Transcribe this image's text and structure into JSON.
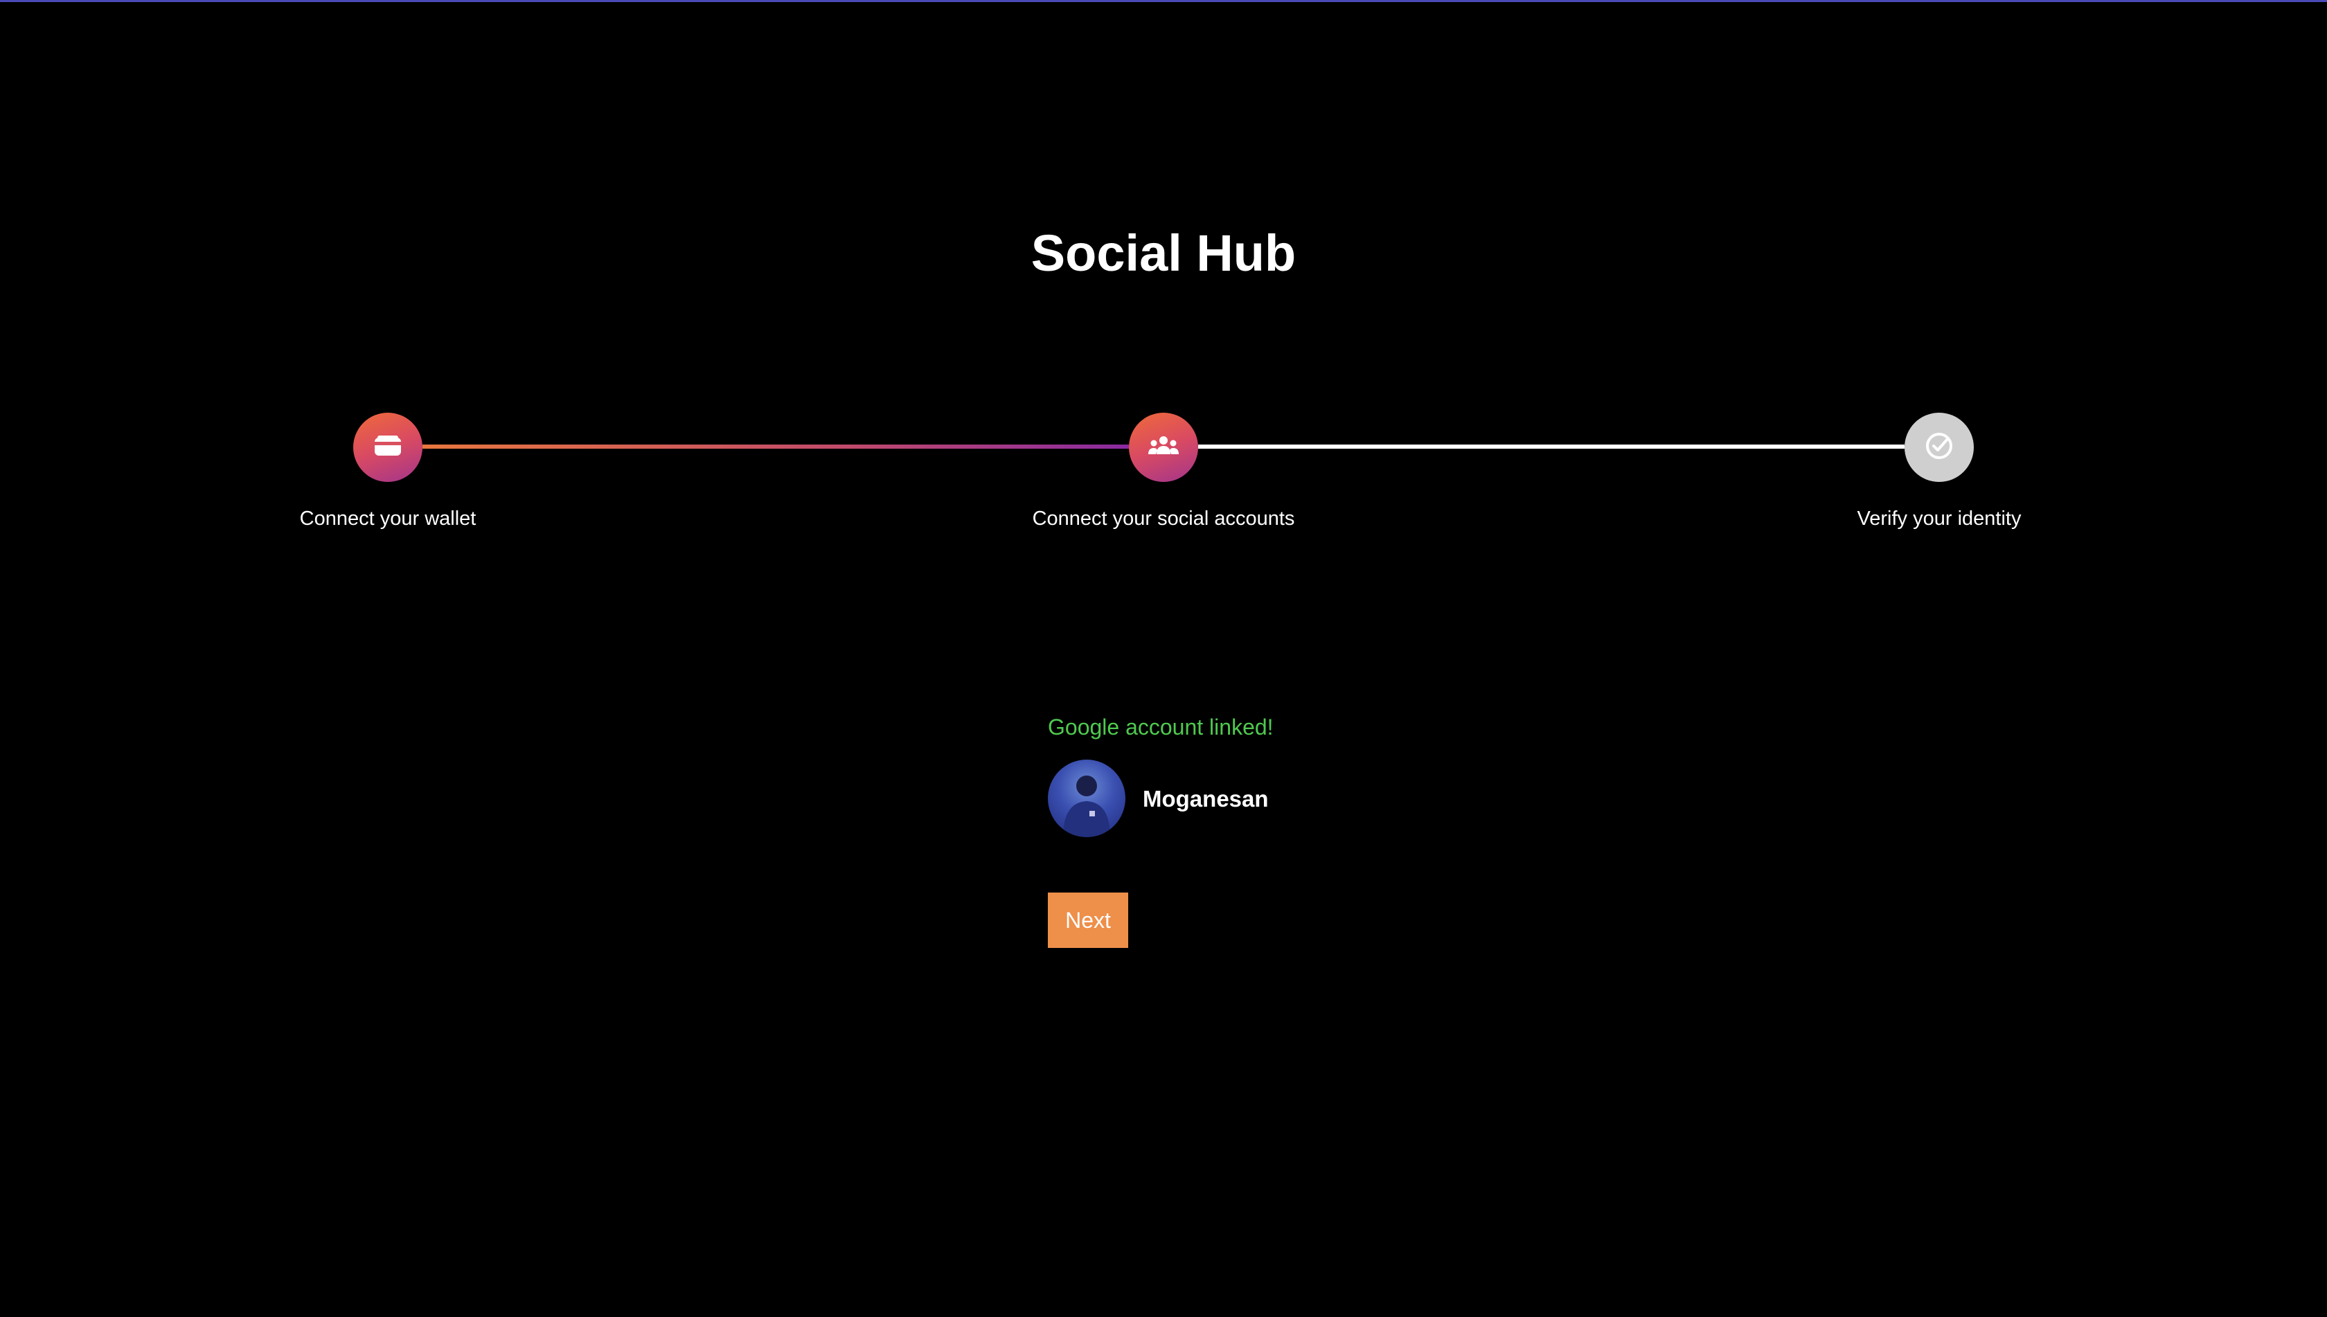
{
  "page": {
    "title": "Social Hub"
  },
  "stepper": {
    "steps": [
      {
        "label": "Connect your wallet",
        "icon": "wallet-icon",
        "status": "completed"
      },
      {
        "label": "Connect your social accounts",
        "icon": "users-icon",
        "status": "active"
      },
      {
        "label": "Verify your identity",
        "icon": "check-circle-icon",
        "status": "pending"
      }
    ]
  },
  "account": {
    "linked_message": "Google account linked!",
    "user_name": "Moganesan"
  },
  "actions": {
    "next_label": "Next"
  },
  "colors": {
    "background": "#000000",
    "accent_orange": "#ee8f4a",
    "success_green": "#4fc94f",
    "step_gradient_start": "#ef6a3a",
    "step_gradient_end": "#a2358c",
    "pending_step": "#cfcfcf"
  }
}
